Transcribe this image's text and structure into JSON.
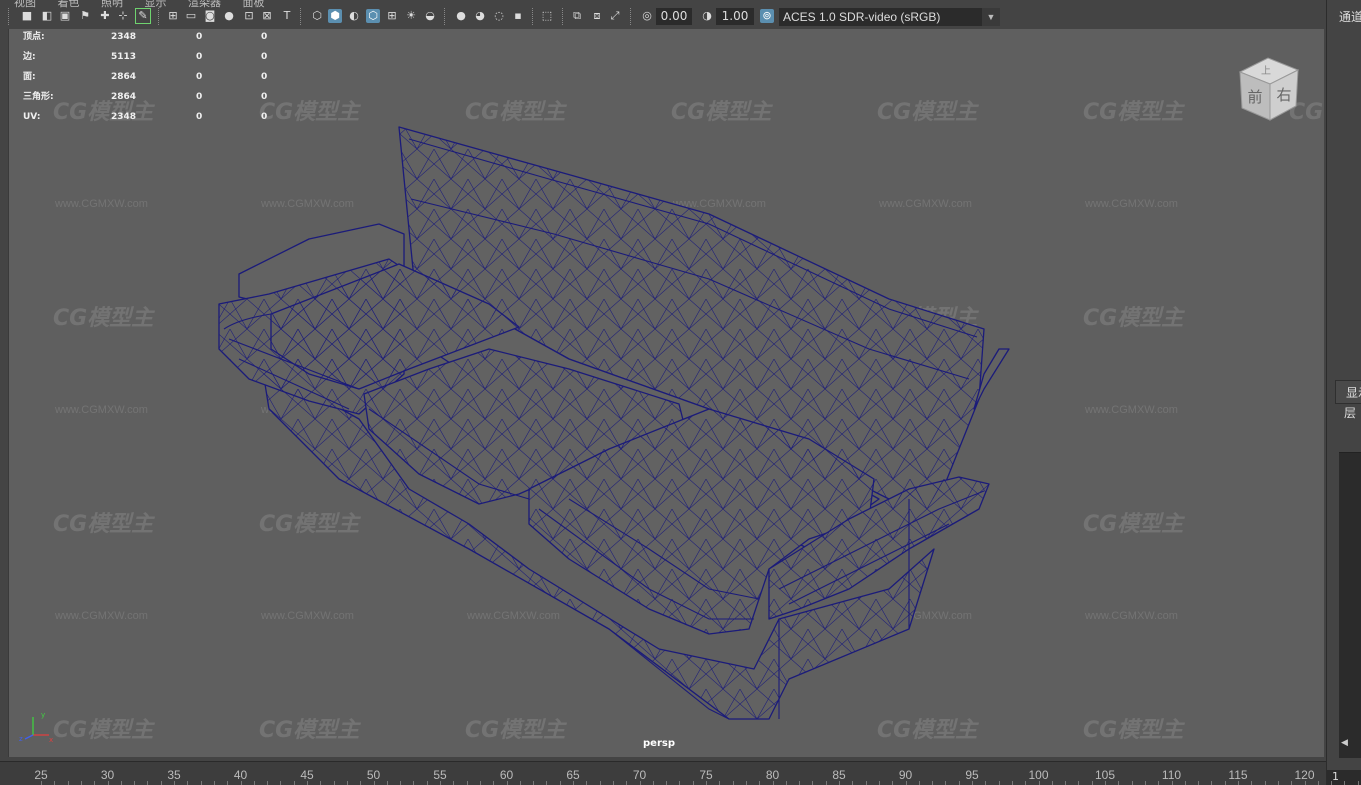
{
  "toolbar": {
    "exposure_value": "0.00",
    "gamma_value": "1.00",
    "color_space": "ACES 1.0 SDR-video (sRGB)",
    "menu_ghost": [
      "视图",
      "着色",
      "照明",
      "显示",
      "渲染器",
      "面板"
    ]
  },
  "hud": {
    "rows": [
      {
        "label": "顶点:",
        "v1": "2348",
        "v2": "0",
        "v3": "0"
      },
      {
        "label": "边:",
        "v1": "5113",
        "v2": "0",
        "v3": "0"
      },
      {
        "label": "面:",
        "v1": "2864",
        "v2": "0",
        "v3": "0"
      },
      {
        "label": "三角形:",
        "v1": "2864",
        "v2": "0",
        "v3": "0"
      },
      {
        "label": "UV:",
        "v1": "2348",
        "v2": "0",
        "v3": "0"
      }
    ]
  },
  "viewport": {
    "camera": "persp",
    "view_cube": {
      "top": "上",
      "front": "前",
      "right": "右"
    },
    "watermark_logo": "CG模型主",
    "watermark_url": "www.CGMXW.com",
    "wire_color": "#1b1b7a",
    "background_color": "#5f5f5f"
  },
  "right_panel": {
    "channel_box": "通道盒",
    "display_tab": "显示",
    "layer_label": "层",
    "frame_value": "1"
  },
  "time_slider": {
    "ticks": [
      "25",
      "30",
      "35",
      "40",
      "45",
      "50",
      "55",
      "60",
      "65",
      "70",
      "75",
      "80",
      "85",
      "90",
      "95",
      "100",
      "105",
      "110",
      "115",
      "120"
    ]
  }
}
